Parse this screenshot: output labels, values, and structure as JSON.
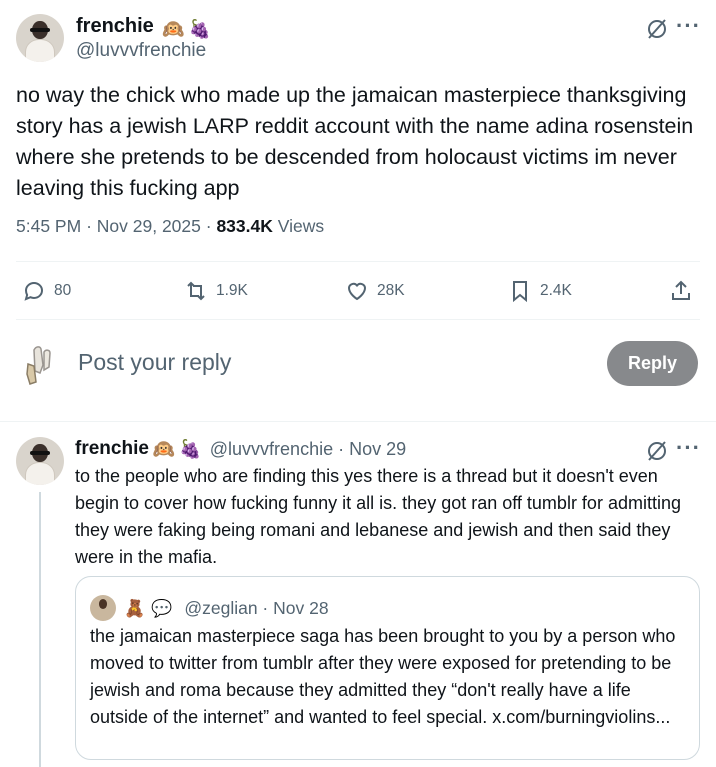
{
  "main_tweet": {
    "display_name": "frenchie",
    "name_emojis": [
      "🙉",
      "🍇"
    ],
    "handle": "@luvvvfrenchie",
    "text": "no way the chick who made up the jamaican masterpiece thanksgiving story has a jewish LARP reddit account with the name adina rosenstein where she pretends to be descended from holocaust victims im never leaving this fucking app",
    "time": "5:45 PM",
    "separator": "·",
    "date": "Nov 29, 2025",
    "views_count": "833.4K",
    "views_label": "Views",
    "actions": {
      "replies": "80",
      "reposts": "1.9K",
      "likes": "28K",
      "bookmarks": "2.4K"
    },
    "more_glyph": "···"
  },
  "reply_composer": {
    "placeholder": "Post your reply",
    "button_label": "Reply"
  },
  "reply_tweet": {
    "display_name": "frenchie",
    "name_emojis": [
      "🙉",
      "🍇"
    ],
    "handle_date": "@luvvvfrenchie · Nov 29",
    "text": "to the people who are finding this yes there is a thread but it doesn't even begin to cover how fucking funny it all is. they got ran off tumblr for admitting they were faking being romani and lebanese and jewish and then said they were in the mafia.",
    "more_glyph": "···"
  },
  "quoted_tweet": {
    "name_emojis": [
      "🧸",
      "💬"
    ],
    "handle_date": "@zeglian · Nov 28",
    "text": "the jamaican masterpiece saga has been brought to you by a person who moved to twitter from tumblr after they were exposed for pretending to be jewish and roma because they admitted they “don't really have a life outside of the internet” and wanted to feel special. x.com/burningviolins..."
  },
  "colors": {
    "text": "#0f1419",
    "secondary": "#536471",
    "reply_button": "#87898c",
    "border": "#cfd9de"
  }
}
